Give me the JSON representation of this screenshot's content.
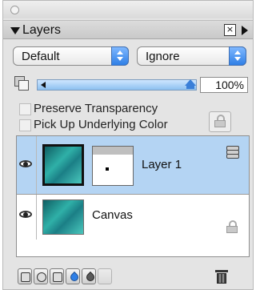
{
  "panel": {
    "title": "Layers"
  },
  "controls": {
    "blend_mode": "Default",
    "composite_method": "Ignore",
    "opacity_value": 1.0,
    "opacity_text": "100%",
    "preserve_transparency": {
      "label": "Preserve Transparency",
      "checked": false
    },
    "pick_up_underlying_color": {
      "label": "Pick Up Underlying Color",
      "checked": false
    }
  },
  "layers": [
    {
      "name": "Layer 1",
      "visible": true,
      "selected": true
    },
    {
      "name": "Canvas",
      "visible": true,
      "selected": false,
      "locked": true
    }
  ],
  "colors": {
    "selection": "#b4d4f3",
    "accent": "#2f7fe6",
    "thumbnail": "#1b7f86"
  },
  "toolbar": {
    "icons": [
      "new-layer-icon",
      "new-layer-mask-icon",
      "group-layers-icon",
      "new-watercolor-layer-icon",
      "new-liquid-ink-layer-icon",
      "disabled-tool-icon",
      "trash-icon"
    ]
  }
}
